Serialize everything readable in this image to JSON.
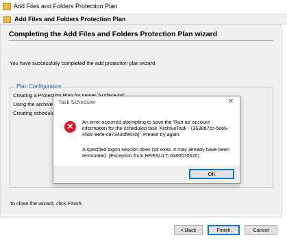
{
  "window": {
    "title": "Add Files and Folders Protection Plan"
  },
  "header": {
    "title": "Add Files and Folders Protection Plan"
  },
  "wizard": {
    "title": "Completing the Add Files and Folders Protection Plan wizard",
    "success_text": "You have successfully completed the add protection plan wizard.",
    "group_title": "Plan Configuration",
    "config_lines": [
      "Creating a Protection Plan for server 'Surface-hd'",
      "Using the archive",
      "Creating schedule"
    ],
    "close_note": "To close the wizard, click Finish.",
    "buttons": {
      "back": "< Back",
      "finish": "Finish",
      "cancel": "Cancel"
    }
  },
  "dialog": {
    "title": "Task Scheduler",
    "close_glyph": "✕",
    "icon": "error-icon",
    "icon_glyph": "✕",
    "message": "An error occurred attempting to save the 'Run as' account information for the scheduled task 'ArchiveTask - {3638d7cc-5ce6-45dc-9efe-c97343df864b}'. Please try again.",
    "detail": "A specified logon session does not exist. It may already have been terminated. (Exception from HRESULT: 0x80070520)",
    "ok_label": "OK"
  },
  "colors": {
    "accent": "#0078d7",
    "error": "#e81123",
    "group_title": "#1c5ca8"
  }
}
